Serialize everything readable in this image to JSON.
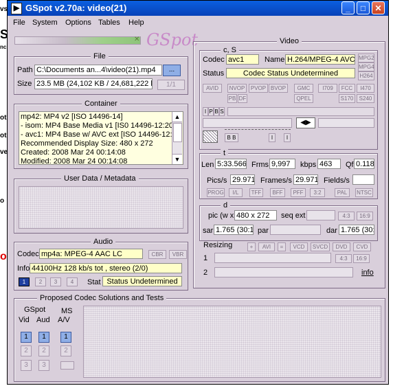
{
  "window": {
    "title": "GSpot v2.70a: video(21)"
  },
  "menu": [
    "File",
    "System",
    "Options",
    "Tables",
    "Help"
  ],
  "logo": "GSpot",
  "file": {
    "title": "File",
    "path_label": "Path",
    "path_value": "C:\\Documents an...4\\video(21).mp4",
    "browse_label": "...",
    "size_label": "Size",
    "size_value": "23.5 MB (24,102 KB / 24,681,222 b",
    "page": "1/1"
  },
  "container": {
    "title": "Container",
    "lines": [
      "mp42: MP4 v2 [ISO 14496-14]",
      "- isom: MP4  Base Media v1 [IS0 14496-12:20",
      "- avc1: MP4 Base w/ AVC ext [ISO 14496-12:",
      "Recommended Display Size: 480 x 272",
      "Created:    2008 Mar 24   00:14:08",
      "Modified:   2008 Mar 24   00:14:08"
    ]
  },
  "userdata": {
    "title": "User Data / Metadata"
  },
  "audio": {
    "title": "Audio",
    "codec_label": "Codec",
    "codec_value": "mp4a: MPEG-4 AAC LC",
    "cbr": "CBR",
    "vbr": "VBR",
    "info_label": "Info",
    "info_value": "44100Hz  128 kb/s tot , stereo (2/0)",
    "tracks": [
      "1",
      "2",
      "3",
      "4"
    ],
    "stat_label": "Stat",
    "stat_value": "Status Undetermined"
  },
  "video": {
    "title": "Video",
    "cs_title": "c, S",
    "codec_label": "Codec",
    "codec_value": "avc1",
    "name_label": "Name",
    "name_value": "H.264/MPEG-4 AVC",
    "status_label": "Status",
    "status_value": "Codec Status Undetermined",
    "side_tags": [
      "MPG2",
      "MPG4",
      "H264"
    ],
    "tags_row1": [
      "AVID",
      "NVOP",
      "PVOP",
      "BVOP",
      "GMC",
      "I709",
      "FCC",
      "I470"
    ],
    "tags_row2": [
      "PB",
      "DF",
      "QPEL",
      "S170",
      "S240"
    ],
    "frame_types": [
      "I",
      "P",
      "B",
      "S"
    ],
    "t_title": "t",
    "len_label": "Len",
    "len_value": "5:33.566",
    "frms_label": "Frms",
    "frms_value": "9,997",
    "kbps_label": "kbps",
    "kbps_value": "463",
    "qf_label": "Qf",
    "qf_value": "0.118",
    "pics_label": "Pics/s",
    "pics_value": "29.971",
    "frames_label": "Frames/s",
    "frames_value": "29.971",
    "fields_label": "Fields/s",
    "fields_value": "",
    "tags_row3": [
      "PROG",
      "I/L",
      "TFF",
      "BFF",
      "PFF",
      "3:2",
      "PAL",
      "NTSC"
    ],
    "d_title": "d",
    "pic_label": "pic (w x",
    "pic_value": "480 x 272",
    "seqext_label": "seq ext",
    "ratio_a": [
      "4:3",
      "16:9"
    ],
    "sar_label": "sar",
    "sar_value": "1.765 (30:17",
    "par_label": "par",
    "dar_label": "dar",
    "dar_value": "1.765 (30:17",
    "resizing_label": "Resizing",
    "resize_btns": [
      "+",
      "AVI",
      "=",
      "VCD",
      "SVCD",
      "DVD",
      "CVD"
    ],
    "row1": "1",
    "row2": "2",
    "ratio_b": [
      "4:3",
      "16:9"
    ],
    "info_link": "info"
  },
  "proposed": {
    "title": "Proposed Codec Solutions and Tests",
    "gspot_label": "GSpot",
    "vid_label": "Vid",
    "aud_label": "Aud",
    "ms_label": "MS",
    "av_label": "A/V",
    "nums": [
      "1",
      "2",
      "3"
    ]
  },
  "desktop": {
    "fragments": [
      "vs,",
      "S",
      "nc.",
      "ot",
      "ot",
      "ve",
      "o",
      "o"
    ]
  }
}
